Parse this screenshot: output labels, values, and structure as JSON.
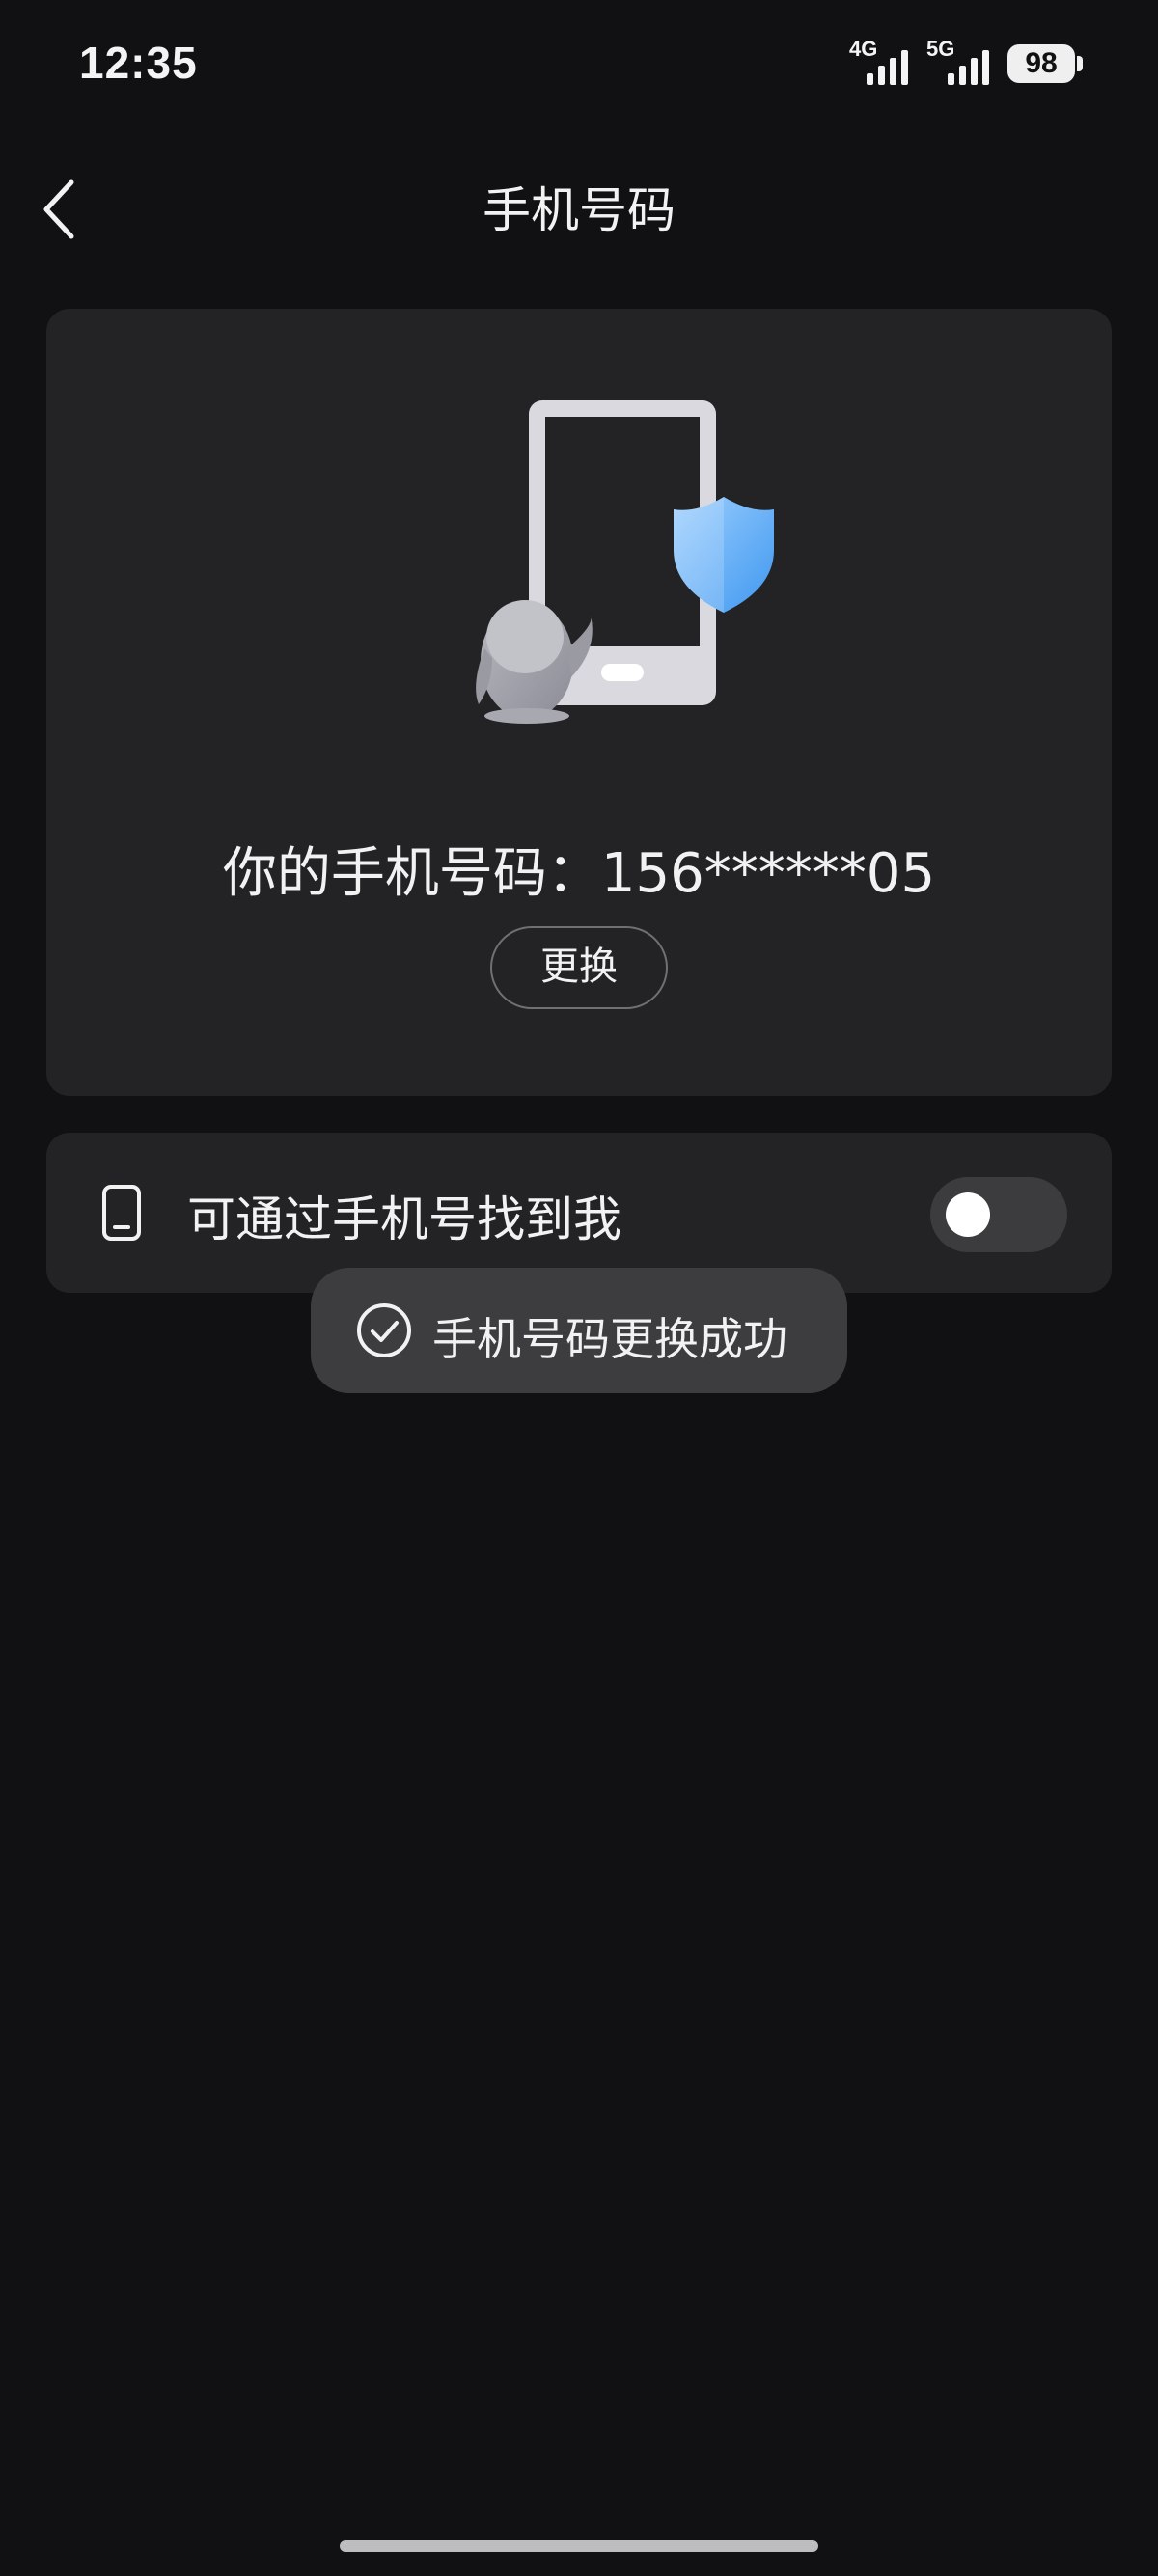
{
  "status_bar": {
    "time": "12:35",
    "network_1": "4G",
    "network_2": "5G",
    "battery": "98"
  },
  "header": {
    "title": "手机号码",
    "back_icon": "chevron-left-icon"
  },
  "card": {
    "illustration_icons": [
      "phone-icon",
      "shield-icon",
      "penguin-icon"
    ],
    "phone_number_text": "你的手机号码：156******05",
    "change_button_label": "更换"
  },
  "setting": {
    "icon": "phone-outline-icon",
    "label": "可通过手机号找到我",
    "toggle_on": false
  },
  "toast": {
    "icon": "check-circle-icon",
    "text": "手机号码更换成功"
  },
  "colors": {
    "background": "#111113",
    "card": "#232326",
    "toast": "#3d3d40",
    "shield_blue": "#5aaaf5"
  }
}
